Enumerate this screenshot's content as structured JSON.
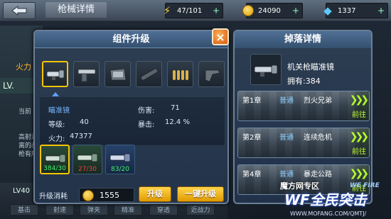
{
  "topbar": {
    "title": "枪械详情",
    "energy": "47/101",
    "coins": "24090",
    "gems": "1337"
  },
  "background": {
    "firepower_label": "火力",
    "lv_label": "LV.",
    "side_text_1": "当前",
    "side_text_2": "高射速",
    "side_text_3": "离的战",
    "side_text_4": "枪有所",
    "lv40": "LV40",
    "bottom_tabs": [
      "基击",
      "射速",
      "弹夹",
      "精准",
      "穿透",
      "近战力"
    ]
  },
  "modal": {
    "title": "组件升级",
    "close": "×",
    "part_icons": [
      "scope-icon",
      "grip-icon",
      "stock-icon",
      "barrel-icon",
      "ammo-icon",
      "handle-icon"
    ],
    "selected_part_index": 0,
    "part_name": "瞄准镜",
    "level_label": "等级:",
    "level_value": "40",
    "damage_label": "伤害:",
    "damage_value": "71",
    "crit_label": "暴击:",
    "crit_value": "12.4 %",
    "firepower_label": "火力:",
    "firepower_value": "47377",
    "materials": [
      {
        "count": "384/30",
        "status": "ok"
      },
      {
        "count": "27/30",
        "status": "bad"
      },
      {
        "count": "83/20",
        "status": "ok"
      }
    ],
    "cost_label": "升级消耗",
    "cost_value": "1555",
    "upgrade_button": "升级",
    "one_click_upgrade_button": "一键升级"
  },
  "drops": {
    "title": "掉落详情",
    "item_name": "机关枪瞄准镜",
    "owned": "拥有:384",
    "chapters": [
      {
        "chapter": "第1章",
        "mode": "普通",
        "name": "烈火兄弟",
        "go": "前往"
      },
      {
        "chapter": "第2章",
        "mode": "普通",
        "name": "连续危机",
        "go": "前往"
      },
      {
        "chapter": "第4章",
        "mode": "普通",
        "name": "暴走公路",
        "go": "前往"
      }
    ]
  },
  "watermark": {
    "line1": "魔方网专区",
    "small": "WE FIRE",
    "logo": "WF全民突击",
    "url": "WWW.MOFANG.COM/QMTJ/"
  }
}
